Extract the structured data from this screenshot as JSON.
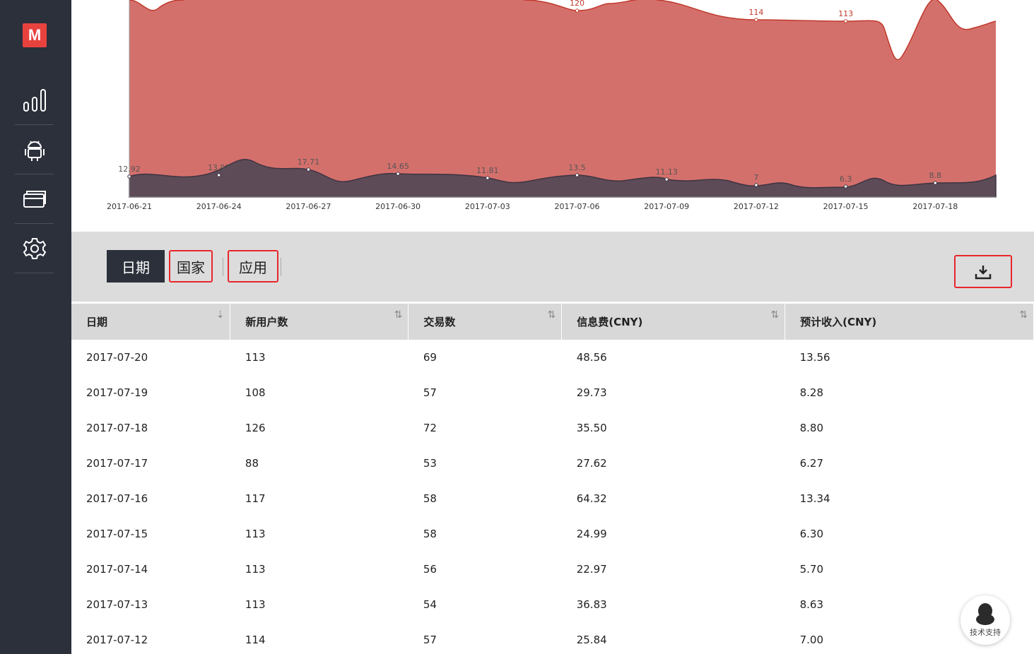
{
  "sidebar": {
    "logo_text": "M",
    "items": [
      {
        "icon": "bar-chart-icon"
      },
      {
        "icon": "android-icon"
      },
      {
        "icon": "credit-card-icon"
      },
      {
        "icon": "gear-icon"
      }
    ]
  },
  "chart_data": {
    "type": "area",
    "x_ticks": [
      "2017-06-21",
      "2017-06-24",
      "2017-06-27",
      "2017-06-30",
      "2017-07-03",
      "2017-07-06",
      "2017-07-09",
      "2017-07-12",
      "2017-07-15",
      "2017-07-18"
    ],
    "top_series_labels": [
      {
        "date": "2017-07-06",
        "value": "120"
      },
      {
        "date": "2017-07-12",
        "value": "114"
      },
      {
        "date": "2017-07-15",
        "value": "113"
      }
    ],
    "bottom_series_labels": [
      {
        "date": "2017-06-21",
        "value": "12.92"
      },
      {
        "date": "2017-06-24",
        "value": "13.93"
      },
      {
        "date": "2017-06-27",
        "value": "17.71"
      },
      {
        "date": "2017-06-30",
        "value": "14.65"
      },
      {
        "date": "2017-07-03",
        "value": "11.81"
      },
      {
        "date": "2017-07-06",
        "value": "13.5"
      },
      {
        "date": "2017-07-09",
        "value": "11.13"
      },
      {
        "date": "2017-07-12",
        "value": "7"
      },
      {
        "date": "2017-07-15",
        "value": "6.3"
      },
      {
        "date": "2017-07-18",
        "value": "8.8"
      }
    ],
    "colors": {
      "top": "#d4706c",
      "top_line": "#c0392b",
      "bottom": "#5d4b57",
      "bottom_line": "#3d3442"
    }
  },
  "toolbar": {
    "tabs": [
      "日期",
      "国家",
      "应用"
    ],
    "download_icon": "download-icon"
  },
  "table": {
    "headers": [
      "日期",
      "新用户数",
      "交易数",
      "信息费(CNY)",
      "预计收入(CNY)"
    ],
    "rows": [
      [
        "2017-07-20",
        "113",
        "69",
        "48.56",
        "13.56"
      ],
      [
        "2017-07-19",
        "108",
        "57",
        "29.73",
        "8.28"
      ],
      [
        "2017-07-18",
        "126",
        "72",
        "35.50",
        "8.80"
      ],
      [
        "2017-07-17",
        "88",
        "53",
        "27.62",
        "6.27"
      ],
      [
        "2017-07-16",
        "117",
        "58",
        "64.32",
        "13.34"
      ],
      [
        "2017-07-15",
        "113",
        "58",
        "24.99",
        "6.30"
      ],
      [
        "2017-07-14",
        "113",
        "56",
        "22.97",
        "5.70"
      ],
      [
        "2017-07-13",
        "113",
        "54",
        "36.83",
        "8.63"
      ],
      [
        "2017-07-12",
        "114",
        "57",
        "25.84",
        "7.00"
      ]
    ]
  },
  "support": {
    "label": "技术支持"
  }
}
